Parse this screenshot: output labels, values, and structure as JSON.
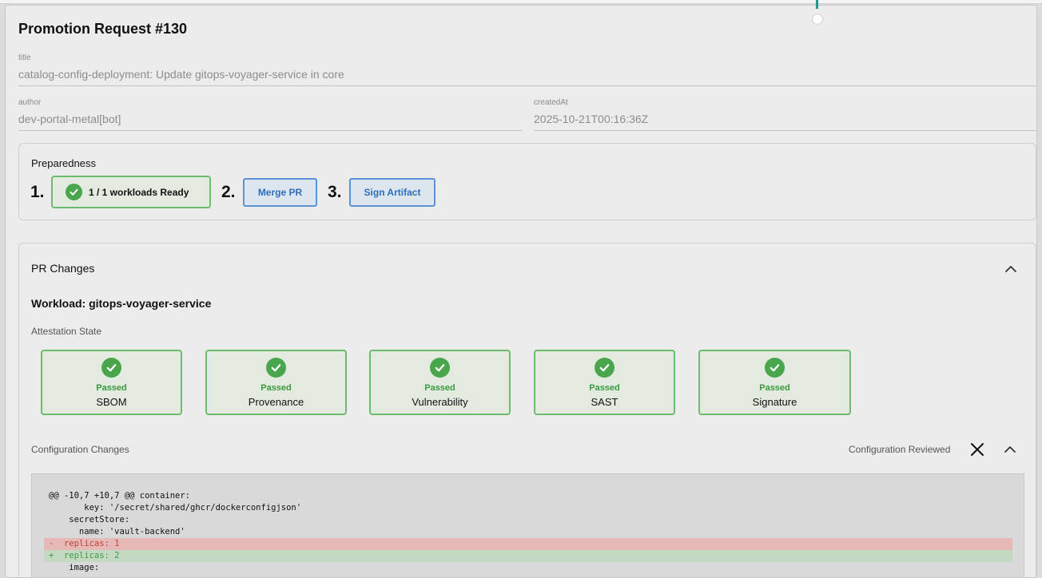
{
  "page": {
    "title": "Promotion Request #130"
  },
  "fields": {
    "title": {
      "label": "title",
      "value": "catalog-config-deployment: Update gitops-voyager-service in core"
    },
    "author": {
      "label": "author",
      "value": "dev-portal-metal[bot]"
    },
    "createdAt": {
      "label": "createdAt",
      "value": "2025-10-21T00:16:36Z"
    }
  },
  "preparedness": {
    "heading": "Preparedness",
    "steps": [
      {
        "number": "1.",
        "label": "1 / 1 workloads Ready",
        "icon": "check-circle-icon"
      },
      {
        "number": "2.",
        "label": "Merge PR"
      },
      {
        "number": "3.",
        "label": "Sign Artifact"
      }
    ]
  },
  "pr_changes": {
    "heading": "PR Changes",
    "workload_title": "Workload: gitops-voyager-service",
    "attestation_heading": "Attestation State",
    "attestations": [
      {
        "status": "Passed",
        "name": "SBOM"
      },
      {
        "status": "Passed",
        "name": "Provenance"
      },
      {
        "status": "Passed",
        "name": "Vulnerability"
      },
      {
        "status": "Passed",
        "name": "SAST"
      },
      {
        "status": "Passed",
        "name": "Signature"
      }
    ],
    "config_heading": "Configuration Changes",
    "config_reviewed_label": "Configuration Reviewed",
    "diff_lines": [
      {
        "type": "ctx",
        "text": "@@ -10,7 +10,7 @@ container:"
      },
      {
        "type": "ctx",
        "text": "       key: '/secret/shared/ghcr/dockerconfigjson'"
      },
      {
        "type": "ctx",
        "text": "    secretStore:"
      },
      {
        "type": "ctx",
        "text": "      name: 'vault-backend'"
      },
      {
        "type": "del",
        "text": "-  replicas: 1"
      },
      {
        "type": "add",
        "text": "+  replicas: 2"
      },
      {
        "type": "ctx",
        "text": "    image:"
      }
    ]
  },
  "colors": {
    "success": "#49a64c",
    "success_border": "#6dbb6d",
    "action_blue": "#2d6fbd",
    "diff_removed_bg": "#e6b9b6",
    "diff_added_bg": "#c3d9c1"
  }
}
